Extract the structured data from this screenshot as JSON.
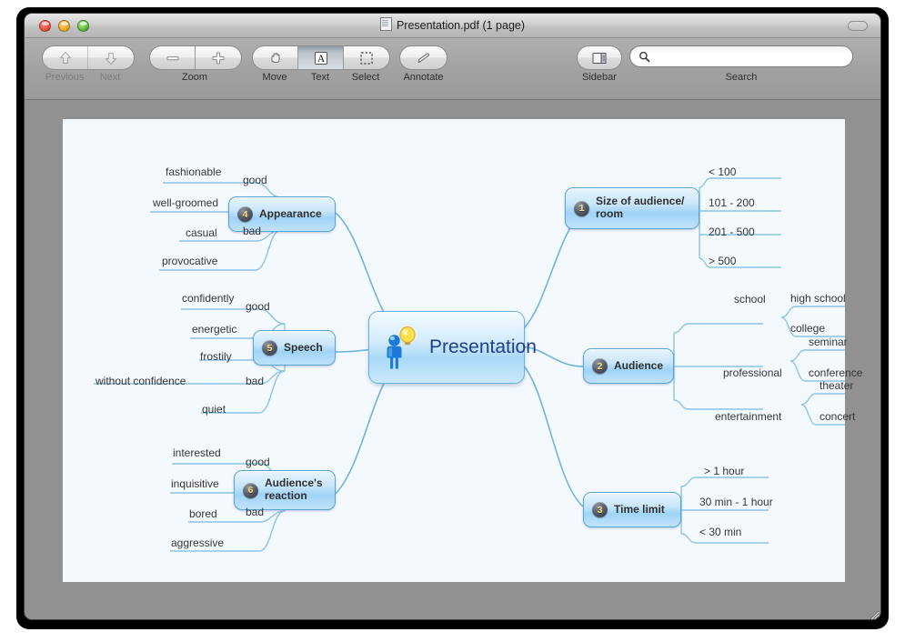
{
  "window": {
    "title": "Presentation.pdf (1 page)",
    "doc_icon": "pdf-document-icon",
    "close_label": "close",
    "minimize_label": "minimize",
    "maximize_label": "maximize"
  },
  "toolbar": {
    "groups": [
      {
        "name": "navigation",
        "buttons": [
          {
            "label": "Previous",
            "icon": "arrow-up-icon",
            "enabled": false
          },
          {
            "label": "Next",
            "icon": "arrow-down-icon",
            "enabled": false
          }
        ]
      },
      {
        "name": "zoom",
        "group_label": "Zoom",
        "buttons": [
          {
            "label": "minus",
            "icon": "minus-icon",
            "enabled": true
          },
          {
            "label": "plus",
            "icon": "plus-icon",
            "enabled": true
          }
        ]
      },
      {
        "name": "tools",
        "buttons": [
          {
            "label": "Move",
            "icon": "hand-icon",
            "selected": false
          },
          {
            "label": "Text",
            "icon": "text-a-icon",
            "selected": true
          },
          {
            "label": "Select",
            "icon": "marquee-select-icon",
            "selected": false
          }
        ]
      },
      {
        "name": "annotate",
        "buttons": [
          {
            "label": "Annotate",
            "icon": "pencil-icon",
            "selected": false
          }
        ]
      },
      {
        "name": "sidebar",
        "buttons": [
          {
            "label": "Sidebar",
            "icon": "sidebar-panel-icon",
            "selected": false
          }
        ]
      }
    ],
    "labels": {
      "previous": "Previous",
      "next": "Next",
      "zoom": "Zoom",
      "move": "Move",
      "text": "Text",
      "select": "Select",
      "annotate": "Annotate",
      "sidebar": "Sidebar",
      "search": "Search"
    },
    "search": {
      "value": "",
      "placeholder": "",
      "icon": "magnifier-icon"
    }
  },
  "mindmap": {
    "center": {
      "label": "Presentation",
      "icon": "person-with-lightbulb-icon"
    },
    "branches": [
      {
        "badge": "4",
        "label": "Appearance",
        "side": "left",
        "groups": [
          {
            "label": "good",
            "items": [
              "fashionable",
              "well-groomed"
            ]
          },
          {
            "label": "bad",
            "items": [
              "casual",
              "provocative"
            ]
          }
        ]
      },
      {
        "badge": "5",
        "label": "Speech",
        "side": "left",
        "groups": [
          {
            "label": "good",
            "items": [
              "confidently",
              "energetic"
            ]
          },
          {
            "label": "bad",
            "items": [
              "frostily",
              "without confidence",
              "quiet"
            ]
          }
        ]
      },
      {
        "badge": "6",
        "label": "Audience's reaction",
        "label_line1": "Audience's",
        "label_line2": "reaction",
        "side": "left",
        "groups": [
          {
            "label": "good",
            "items": [
              "interested",
              "inquisitive"
            ]
          },
          {
            "label": "bad",
            "items": [
              "bored",
              "aggressive"
            ]
          }
        ]
      },
      {
        "badge": "1",
        "label": "Size of audience/ room",
        "label_line1": "Size of audience/",
        "label_line2": "room",
        "side": "right",
        "items": [
          "< 100",
          "101 - 200",
          "201 - 500",
          "> 500"
        ]
      },
      {
        "badge": "2",
        "label": "Audience",
        "side": "right",
        "groups": [
          {
            "label": "school",
            "items": [
              "high school",
              "college"
            ]
          },
          {
            "label": "professional",
            "items": [
              "seminar",
              "conference"
            ]
          },
          {
            "label": "entertainment",
            "items": [
              "theater",
              "concert"
            ]
          }
        ]
      },
      {
        "badge": "3",
        "label": "Time limit",
        "side": "right",
        "items": [
          "> 1 hour",
          "30 min - 1 hour",
          "< 30 min"
        ]
      }
    ]
  },
  "colors": {
    "page_background": "#f4f9fd",
    "node_border": "#59a5d8",
    "connector": "#6fb3e0",
    "center_text": "#1c3f8f",
    "badge_number": "#ffe27a",
    "window_chrome": "#9a9a9a"
  }
}
